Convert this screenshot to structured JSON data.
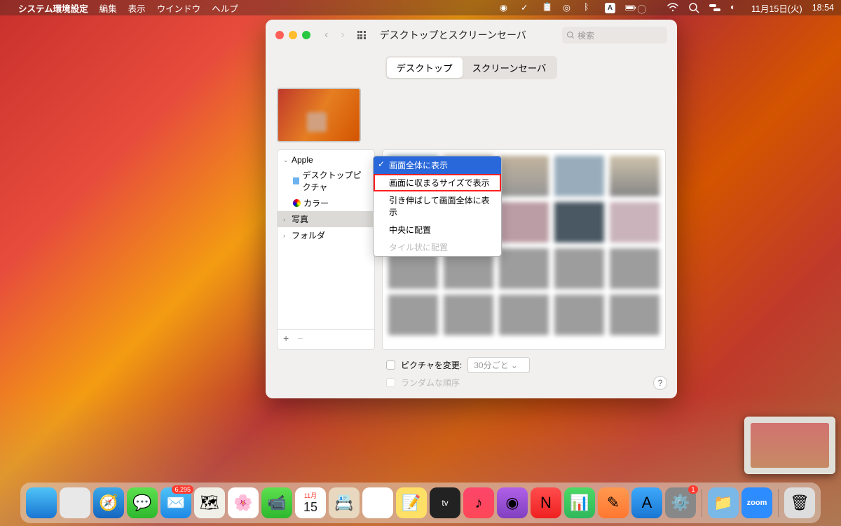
{
  "menubar": {
    "app": "システム環境設定",
    "items": [
      "編集",
      "表示",
      "ウインドウ",
      "ヘルプ"
    ],
    "date": "11月15日(火)",
    "time": "18:54"
  },
  "window": {
    "title": "デスクトップとスクリーンセーバ",
    "search_placeholder": "検索",
    "tabs": {
      "desktop": "デスクトップ",
      "screensaver": "スクリーンセーバ"
    },
    "sidebar": {
      "apple": "Apple",
      "desktop_pictures": "デスクトップピクチャ",
      "colors": "カラー",
      "photos": "写真",
      "folders": "フォルダ"
    },
    "dropdown": {
      "fill": "画面全体に表示",
      "fit": "画面に収まるサイズで表示",
      "stretch": "引き伸ばして画面全体に表示",
      "center": "中央に配置",
      "tile": "タイル状に配置"
    },
    "options": {
      "change": "ピクチャを変更:",
      "interval": "30分ごと",
      "random": "ランダムな順序"
    }
  },
  "dock": {
    "mail_badge": "6,295",
    "sys_badge": "1",
    "cal_top": "11月",
    "cal_day": "15",
    "zoom": "zoom"
  }
}
